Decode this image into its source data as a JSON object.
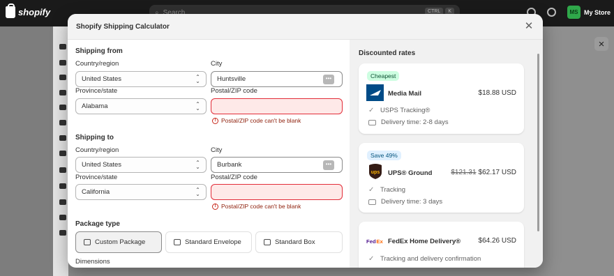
{
  "topbar": {
    "brand": "shopify",
    "search_placeholder": "Search",
    "shortcut_keys": [
      "CTRL",
      "K"
    ],
    "store_initials": "MS",
    "store_name": "My Store"
  },
  "modal": {
    "title": "Shopify Shipping Calculator",
    "shipping_from": {
      "heading": "Shipping from",
      "country_label": "Country/region",
      "country_value": "United States",
      "city_label": "City",
      "city_value": "Huntsville",
      "province_label": "Province/state",
      "province_value": "Alabama",
      "postal_label": "Postal/ZIP code",
      "postal_value": "",
      "postal_error": "Postal/ZIP code can't be blank"
    },
    "shipping_to": {
      "heading": "Shipping to",
      "country_label": "Country/region",
      "country_value": "United States",
      "city_label": "City",
      "city_value": "Burbank",
      "province_label": "Province/state",
      "province_value": "California",
      "postal_label": "Postal/ZIP code",
      "postal_value": "",
      "postal_error": "Postal/ZIP code can't be blank"
    },
    "package": {
      "heading": "Package type",
      "options": [
        "Custom Package",
        "Standard Envelope",
        "Standard Box"
      ],
      "selected": "Custom Package",
      "dimensions_label": "Dimensions"
    },
    "rates": {
      "heading": "Discounted rates",
      "cards": [
        {
          "badge": "Cheapest",
          "carrier_logo": "usps-logo",
          "service": "Media Mail",
          "price": "$18.88 USD",
          "old_price": "",
          "features": [
            "USPS Tracking®",
            "Delivery time: 2-8 days"
          ]
        },
        {
          "badge": "Save 49%",
          "carrier_logo": "ups-logo",
          "service": "UPS® Ground",
          "price": "$62.17 USD",
          "old_price": "$121.31",
          "features": [
            "Tracking",
            "Delivery time: 3 days"
          ]
        },
        {
          "badge": "",
          "carrier_logo": "fedex-logo",
          "service": "FedEx Home Delivery®",
          "price": "$64.26 USD",
          "old_price": "",
          "features": [
            "Tracking and delivery confirmation"
          ]
        }
      ]
    }
  },
  "colors": {
    "error_bg": "#fee9e8",
    "error_border": "#e22c38",
    "error_text": "#8e1f0b",
    "badge_green_bg": "#cdfee1",
    "badge_blue_bg": "#e0f0ff",
    "usps_blue": "#004b87",
    "ups_brown": "#351c15",
    "ups_gold": "#ffb500",
    "fedex_purple": "#4d148c",
    "fedex_orange": "#ff6600"
  }
}
